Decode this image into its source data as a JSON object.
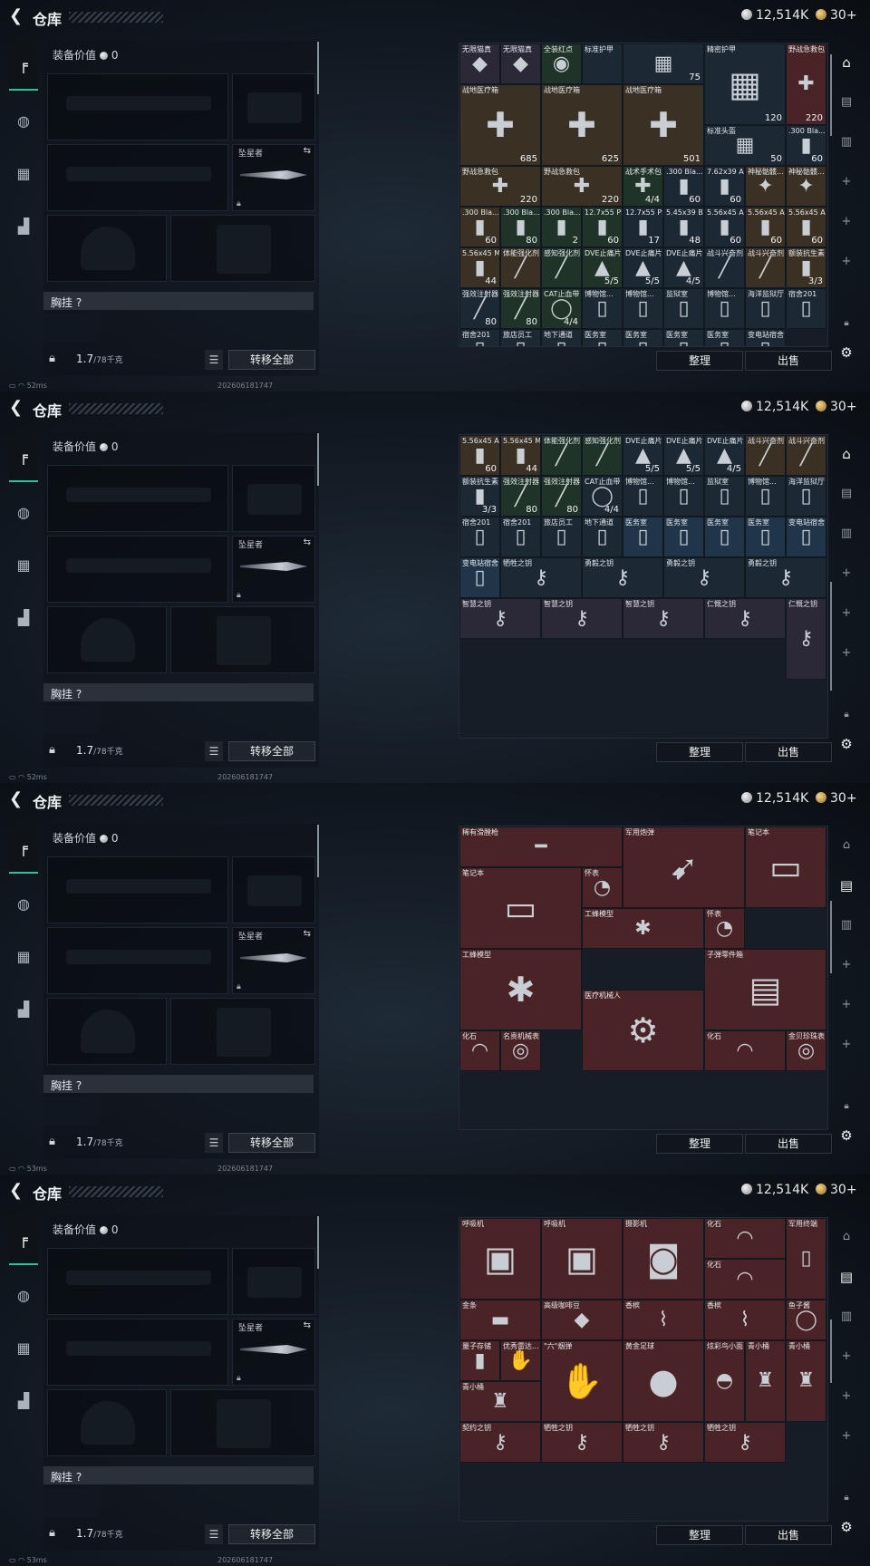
{
  "header": {
    "back_icon": "chevron-left-icon",
    "title": "仓库",
    "silver": "12,514K",
    "gold": "30+"
  },
  "equipment": {
    "value_label": "装备价值",
    "value": "0",
    "melee_label": "坠星者",
    "chest_label": "胸挂 ?",
    "weight": "1.7",
    "weight_max": "/78千克",
    "transfer_all": "转移全部"
  },
  "actions": {
    "sort": "整理",
    "sell": "出售"
  },
  "status": {
    "ping": [
      "52ms",
      "52ms",
      "53ms",
      "53ms"
    ],
    "timestamp": "202606181747"
  },
  "colors": {
    "accent": "#2fbf9a",
    "legendary": "#4a2326",
    "rare": "#20354a"
  },
  "panels": [
    {
      "items": [
        {
          "n": "无限猫真",
          "ct": "",
          "ic": "◆"
        },
        {
          "n": "无限猫真",
          "ct": "",
          "ic": "◆"
        },
        {
          "n": "全装红点",
          "ct": "",
          "ic": "◉"
        },
        {
          "n": "标准护甲",
          "ct": "",
          "ic": ""
        },
        {
          "n": "",
          "ct": "75",
          "ic": "▦"
        },
        {
          "n": "精密护甲",
          "ct": "120",
          "ic": "▦"
        },
        {
          "n": "野战急救包",
          "ct": "220",
          "ic": "✚"
        },
        {
          "n": "战地医疗箱",
          "ct": "685",
          "ic": "✚"
        },
        {
          "n": "战地医疗箱",
          "ct": "625",
          "ic": "✚"
        },
        {
          "n": "战地医疗箱",
          "ct": "501",
          "ic": "✚"
        },
        {
          "n": "标准头盔",
          "ct": "50",
          "ic": "▦"
        },
        {
          "n": ".300 Bla... TAC-FX",
          "ct": "60",
          "ic": "▮"
        },
        {
          "n": "野战急救包",
          "ct": "220",
          "ic": "✚"
        },
        {
          "n": "野战急救包",
          "ct": "220",
          "ic": "✚"
        },
        {
          "n": "战术手术包",
          "ct": "4/4",
          "ic": "✚"
        },
        {
          "n": ".300 Bla... TAC-FX",
          "ct": "60",
          "ic": "▮"
        },
        {
          "n": "7.62x39 AP",
          "ct": "60",
          "ic": "▮"
        },
        {
          "n": "神秘骷髅...",
          "ct": "",
          "ic": "✦"
        },
        {
          "n": "神秘骷髅...",
          "ct": "",
          "ic": "✦"
        },
        {
          "n": ".300 Bla... BCP FMJ",
          "ct": "60",
          "ic": "▮"
        },
        {
          "n": ".300 Bla... BCP FMJ",
          "ct": "80",
          "ic": "▮"
        },
        {
          "n": ".300 Bla... BCP FMJ",
          "ct": "2",
          "ic": "▮"
        },
        {
          "n": "12.7x55 PS12A",
          "ct": "60",
          "ic": "▮"
        },
        {
          "n": "12.7x55 PS12A",
          "ct": "17",
          "ic": "▮"
        },
        {
          "n": "5.45x39 BT",
          "ct": "48",
          "ic": "▮"
        },
        {
          "n": "5.56x45 AP",
          "ct": "60",
          "ic": "▮"
        },
        {
          "n": "5.56x45 AP",
          "ct": "60",
          "ic": "▮"
        },
        {
          "n": "5.56x45 AP",
          "ct": "60",
          "ic": "▮"
        },
        {
          "n": "5.56x45 M855A1",
          "ct": "44",
          "ic": "▮"
        },
        {
          "n": "体能强化剂",
          "ct": "",
          "ic": "╱"
        },
        {
          "n": "感知强化剂",
          "ct": "",
          "ic": "╱"
        },
        {
          "n": "DVE止痛片",
          "ct": "5/5",
          "ic": "▲"
        },
        {
          "n": "DVE止痛片",
          "ct": "5/5",
          "ic": "▲"
        },
        {
          "n": "DVE止痛片",
          "ct": "4/5",
          "ic": "▲"
        },
        {
          "n": "战斗兴奋剂",
          "ct": "",
          "ic": "╱"
        },
        {
          "n": "战斗兴奋剂",
          "ct": "",
          "ic": "╱"
        },
        {
          "n": "额装抗生素",
          "ct": "3/3",
          "ic": "▮"
        },
        {
          "n": "强效注射器",
          "ct": "80",
          "ic": "╱"
        },
        {
          "n": "强效注射器",
          "ct": "80",
          "ic": "╱"
        },
        {
          "n": "CAT止血带",
          "ct": "4/4",
          "ic": "◯"
        },
        {
          "n": "博物馆...",
          "ct": "",
          "ic": "▯"
        },
        {
          "n": "博物馆...",
          "ct": "",
          "ic": "▯"
        },
        {
          "n": "监狱室",
          "ct": "",
          "ic": "▯"
        },
        {
          "n": "博物馆...",
          "ct": "",
          "ic": "▯"
        },
        {
          "n": "海洋监狱厅",
          "ct": "",
          "ic": "▯"
        },
        {
          "n": "宿舍201",
          "ct": "",
          "ic": "▯"
        },
        {
          "n": "宿舍201",
          "ct": "",
          "ic": "▯"
        },
        {
          "n": "旅店员工",
          "ct": "",
          "ic": "▯"
        },
        {
          "n": "地下通道",
          "ct": "",
          "ic": "▯"
        },
        {
          "n": "医务室",
          "ct": "",
          "ic": "▯"
        },
        {
          "n": "医务室",
          "ct": "",
          "ic": "▯"
        },
        {
          "n": "医务室",
          "ct": "",
          "ic": "▯"
        },
        {
          "n": "医务室",
          "ct": "",
          "ic": "▯"
        },
        {
          "n": "变电站宿舍",
          "ct": "",
          "ic": "▯"
        }
      ]
    },
    {
      "items": [
        {
          "n": "5.56x45 AP",
          "ct": "60",
          "ic": "▮"
        },
        {
          "n": "5.56x45 M855A1",
          "ct": "44",
          "ic": "▮"
        },
        {
          "n": "体能强化剂",
          "ct": "",
          "ic": "╱"
        },
        {
          "n": "感知强化剂",
          "ct": "",
          "ic": "╱"
        },
        {
          "n": "DVE止痛片",
          "ct": "5/5",
          "ic": "▲"
        },
        {
          "n": "DVE止痛片",
          "ct": "5/5",
          "ic": "▲"
        },
        {
          "n": "DVE止痛片",
          "ct": "4/5",
          "ic": "▲"
        },
        {
          "n": "战斗兴奋剂",
          "ct": "",
          "ic": "╱"
        },
        {
          "n": "战斗兴奋剂",
          "ct": "",
          "ic": "╱"
        },
        {
          "n": "额装抗生素",
          "ct": "3/3",
          "ic": "▮"
        },
        {
          "n": "强效注射器",
          "ct": "80",
          "ic": "╱"
        },
        {
          "n": "强效注射器",
          "ct": "80",
          "ic": "╱"
        },
        {
          "n": "CAT止血带",
          "ct": "4/4",
          "ic": "◯"
        },
        {
          "n": "博物馆...",
          "ct": "",
          "ic": "▯"
        },
        {
          "n": "博物馆...",
          "ct": "",
          "ic": "▯"
        },
        {
          "n": "监狱室",
          "ct": "",
          "ic": "▯"
        },
        {
          "n": "博物馆...",
          "ct": "",
          "ic": "▯"
        },
        {
          "n": "海洋监狱厅",
          "ct": "",
          "ic": "▯"
        },
        {
          "n": "宿舍201",
          "ct": "",
          "ic": "▯"
        },
        {
          "n": "宿舍201",
          "ct": "",
          "ic": "▯"
        },
        {
          "n": "旅店员工",
          "ct": "",
          "ic": "▯"
        },
        {
          "n": "地下通道",
          "ct": "",
          "ic": "▯"
        },
        {
          "n": "医务室",
          "ct": "",
          "ic": "▯"
        },
        {
          "n": "医务室",
          "ct": "",
          "ic": "▯"
        },
        {
          "n": "医务室",
          "ct": "",
          "ic": "▯"
        },
        {
          "n": "医务室",
          "ct": "",
          "ic": "▯"
        },
        {
          "n": "变电站宿舍",
          "ct": "",
          "ic": "▯"
        },
        {
          "n": "变电站宿舍",
          "ct": "",
          "ic": "▯"
        },
        {
          "n": "牺牲之钥",
          "ct": "",
          "ic": "⚷"
        },
        {
          "n": "勇毅之钥",
          "ct": "",
          "ic": "⚷"
        },
        {
          "n": "勇毅之钥",
          "ct": "",
          "ic": "⚷"
        },
        {
          "n": "勇毅之钥",
          "ct": "",
          "ic": "⚷"
        },
        {
          "n": "智慧之钥",
          "ct": "",
          "ic": "⚷"
        },
        {
          "n": "智慧之钥",
          "ct": "",
          "ic": "⚷"
        },
        {
          "n": "智慧之钥",
          "ct": "",
          "ic": "⚷"
        },
        {
          "n": "仁慨之钥",
          "ct": "",
          "ic": "⚷"
        },
        {
          "n": "仁慨之钥",
          "ct": "",
          "ic": "⚷"
        }
      ]
    },
    {
      "items": [
        {
          "n": "稀有滑膛枪",
          "ct": "",
          "ic": "━"
        },
        {
          "n": "军用炮弹",
          "ct": "",
          "ic": "➹"
        },
        {
          "n": "笔记本",
          "ct": "",
          "ic": "▭"
        },
        {
          "n": "笔记本",
          "ct": "",
          "ic": "▭"
        },
        {
          "n": "怀表",
          "ct": "",
          "ic": "◔"
        },
        {
          "n": "工蜂模型",
          "ct": "",
          "ic": "✱"
        },
        {
          "n": "怀表",
          "ct": "",
          "ic": "◔"
        },
        {
          "n": "工蜂模型",
          "ct": "",
          "ic": "✱"
        },
        {
          "n": "医疗机械人",
          "ct": "",
          "ic": "⚙"
        },
        {
          "n": "子弹零件箱",
          "ct": "",
          "ic": "▤"
        },
        {
          "n": "化石",
          "ct": "",
          "ic": "◠"
        },
        {
          "n": "名贵机械表",
          "ct": "",
          "ic": "◎"
        },
        {
          "n": "化石",
          "ct": "",
          "ic": "◠"
        },
        {
          "n": "金贝珍珠表",
          "ct": "",
          "ic": "◎"
        }
      ]
    },
    {
      "items": [
        {
          "n": "呼吸机",
          "ct": "",
          "ic": "▣"
        },
        {
          "n": "呼吸机",
          "ct": "",
          "ic": "▣"
        },
        {
          "n": "摄影机",
          "ct": "",
          "ic": "◙"
        },
        {
          "n": "化石",
          "ct": "",
          "ic": "◠"
        },
        {
          "n": "军用终端",
          "ct": "",
          "ic": "▯"
        },
        {
          "n": "化石",
          "ct": "",
          "ic": "◠"
        },
        {
          "n": "金条",
          "ct": "",
          "ic": "▬"
        },
        {
          "n": "高级咖啡豆",
          "ct": "",
          "ic": "◆"
        },
        {
          "n": "香槟",
          "ct": "",
          "ic": "⌇"
        },
        {
          "n": "香槟",
          "ct": "",
          "ic": "⌇"
        },
        {
          "n": "鱼子酱",
          "ct": "",
          "ic": "◯"
        },
        {
          "n": "量子存储",
          "ct": "",
          "ic": "▮"
        },
        {
          "n": "优秀雷达...",
          "ct": "",
          "ic": "✋"
        },
        {
          "n": "\"六\"烟弹",
          "ct": "",
          "ic": "✋"
        },
        {
          "n": "黄金足球",
          "ct": "",
          "ic": "●"
        },
        {
          "n": "炫彩鸟小面",
          "ct": "",
          "ic": "◓"
        },
        {
          "n": "青小桶",
          "ct": "",
          "ic": "♜"
        },
        {
          "n": "青小桶",
          "ct": "",
          "ic": "♜"
        },
        {
          "n": "青小桶",
          "ct": "",
          "ic": "♜"
        },
        {
          "n": "契约之钥",
          "ct": "",
          "ic": "⚷"
        },
        {
          "n": "牺牲之钥",
          "ct": "",
          "ic": "⚷"
        },
        {
          "n": "牺牲之钥",
          "ct": "",
          "ic": "⚷"
        },
        {
          "n": "牺牲之钥",
          "ct": "",
          "ic": "⚷"
        }
      ]
    }
  ]
}
